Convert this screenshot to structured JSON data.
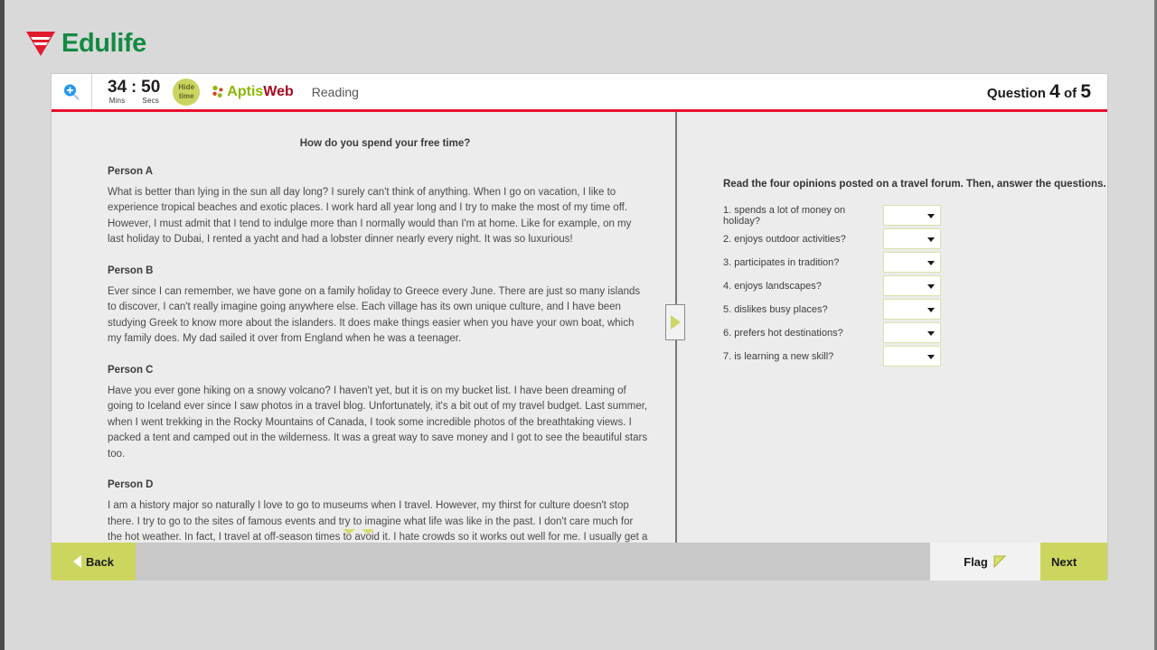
{
  "brand": {
    "name": "Edulife"
  },
  "toolbar": {
    "zoom_icon": "zoom-in-magnifier-icon",
    "timer": {
      "minutes": "34",
      "separator": ":",
      "seconds": "50",
      "minutes_label": "Mins",
      "seconds_label": "Secs"
    },
    "hide_time": {
      "line1": "Hide",
      "line2": "time"
    },
    "logo": {
      "part1": "Aptis",
      "part2": "Web"
    },
    "skill": "Reading",
    "question_counter": {
      "prefix": "Question",
      "current": "4",
      "of": "of",
      "total": "5"
    }
  },
  "passage": {
    "title": "How do you spend your free time?",
    "people": [
      {
        "name": "Person A",
        "text": "What is better than lying in the sun all day long? I surely can't think of anything. When I go on vacation, I like to experience tropical beaches and exotic places. I work hard all year long and I try to make the most of my time off. However, I must admit that I tend to indulge more than I normally would than I'm at home. Like for example, on my last holiday to Dubai, I rented a yacht and had a lobster dinner nearly every night. It was so luxurious!"
      },
      {
        "name": "Person B",
        "text": "Ever since I can remember, we have gone on a family holiday to Greece every June. There are just so many islands to discover, I can't really imagine going anywhere else. Each village has its own unique culture, and I have been studying Greek to know more about the islanders. It does make things easier when you have your own boat, which my family does. My dad sailed it over from England when he was a teenager."
      },
      {
        "name": "Person C",
        "text": "Have you ever gone hiking on a snowy volcano? I haven't yet, but it is on my bucket list. I have been dreaming of going to Iceland ever since I saw photos in a travel blog. Unfortunately, it's a bit out of my travel budget. Last summer, when I went trekking in the Rocky Mountains of Canada, I took some incredible photos of the breathtaking views. I packed a tent and camped out in the wilderness. It was a great way to save money and I got to see the beautiful stars too."
      },
      {
        "name": "Person D",
        "text": "I am a history major so naturally I love to go to museums when I travel. However, my thirst for culture doesn't stop there. I try to go to the sites of famous events and try to imagine what life was like in the past. I don't care much for the hot weather. In fact, I travel at off-season times to avoid it. I hate crowds so it works out well for me. I usually get a cheaper rate on flights that way, which is a bonus. I use the money I save to book all of my excursions"
      }
    ]
  },
  "questions_panel": {
    "instruction": "Read the four opinions posted on a travel forum. Then, answer the questions.",
    "items": [
      {
        "label": "1. spends a lot of money on holiday?",
        "value": ""
      },
      {
        "label": "2. enjoys outdoor activities?",
        "value": ""
      },
      {
        "label": "3. participates in tradition?",
        "value": ""
      },
      {
        "label": "4. enjoys landscapes?",
        "value": ""
      },
      {
        "label": "5. dislikes busy places?",
        "value": ""
      },
      {
        "label": "6. prefers hot destinations?",
        "value": ""
      },
      {
        "label": "7. is learning a new skill?",
        "value": ""
      }
    ]
  },
  "footer": {
    "back_label": "Back",
    "flag_label": "Flag",
    "next_label": "Next"
  },
  "colors": {
    "accent_green": "#ccd65f",
    "brand_green": "#128a43",
    "brand_red": "#e8112d",
    "rule_red": "#e8112d"
  }
}
